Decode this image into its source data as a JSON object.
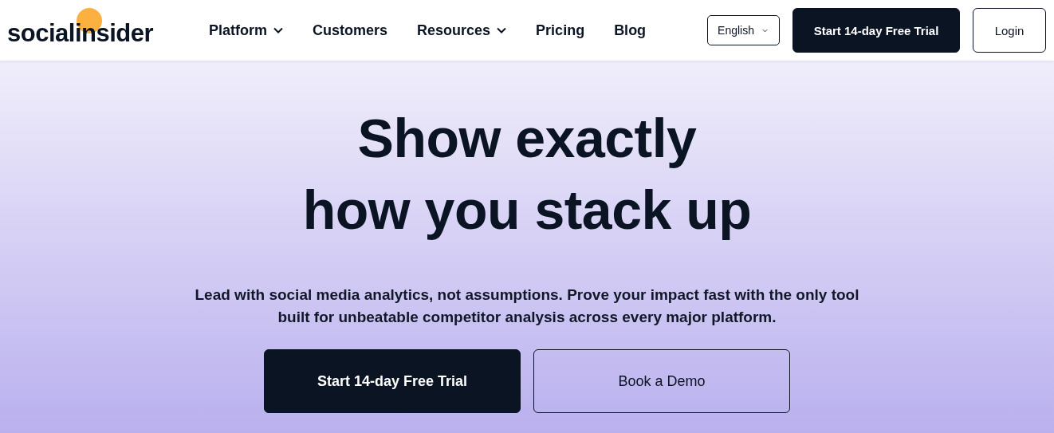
{
  "header": {
    "logo": "socialinsider",
    "nav": [
      {
        "label": "Platform",
        "has_menu": true
      },
      {
        "label": "Customers",
        "has_menu": false
      },
      {
        "label": "Resources",
        "has_menu": true
      },
      {
        "label": "Pricing",
        "has_menu": false
      },
      {
        "label": "Blog",
        "has_menu": false
      }
    ],
    "language": "English",
    "trial_button": "Start 14-day Free Trial",
    "login_button": "Login"
  },
  "hero": {
    "headline": [
      "Show exactly",
      "how you stack up"
    ],
    "text": "Lead with social media analytics, not assumptions. Prove your impact fast with the only tool built for unbeatable competitor analysis across every major platform.",
    "buttons": [
      {
        "label": "Start 14-day Free Trial",
        "kind": "primary"
      },
      {
        "label": "Book a Demo",
        "kind": "outline"
      }
    ]
  }
}
